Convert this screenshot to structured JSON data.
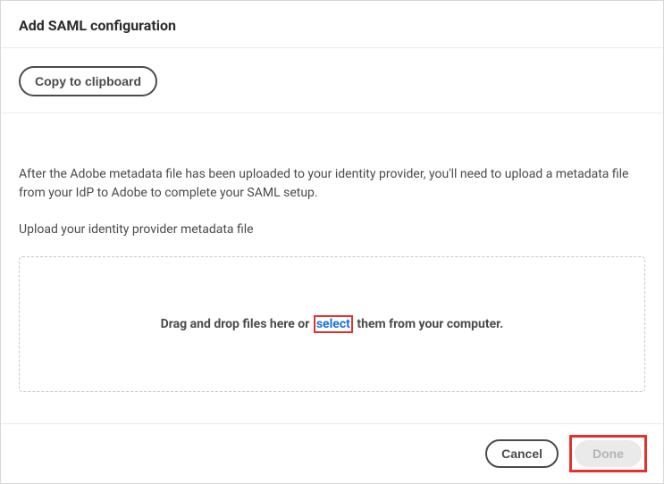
{
  "header": {
    "title": "Add SAML configuration"
  },
  "copySection": {
    "buttonLabel": "Copy to clipboard"
  },
  "main": {
    "instruction": "After the Adobe metadata file has been uploaded to your identity provider, you'll need to upload a metadata file from your IdP to Adobe to complete your SAML setup.",
    "uploadLabel": "Upload your identity provider metadata file",
    "dropzone": {
      "textBefore": "Drag and drop files here or ",
      "selectLink": "select",
      "textAfter": " them from your computer."
    }
  },
  "footer": {
    "cancelLabel": "Cancel",
    "doneLabel": "Done"
  }
}
